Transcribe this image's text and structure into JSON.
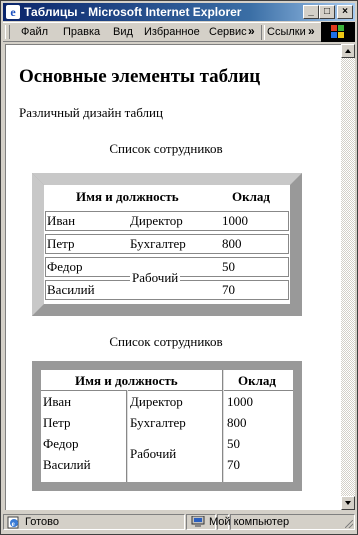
{
  "window": {
    "title": "Таблицы - Microsoft Internet Explorer",
    "buttons": {
      "minimize": "_",
      "maximize": "□",
      "close": "×"
    }
  },
  "menubar": {
    "items": [
      "Файл",
      "Правка",
      "Вид",
      "Избранное",
      "Сервис"
    ],
    "overflow": "»",
    "links_label": "Ссылки",
    "links_overflow": "»"
  },
  "page": {
    "heading": "Основные элементы таблиц",
    "subheading": "Различный дизайн таблиц",
    "table1": {
      "caption": "Список сотрудников",
      "headers": [
        "Имя и должность",
        "Оклад"
      ],
      "rows": [
        {
          "name": "Иван",
          "position": "Директор",
          "salary": "1000"
        },
        {
          "name": "Петр",
          "position": "Бухгалтер",
          "salary": "800"
        },
        {
          "name": "Федор",
          "position": "",
          "salary": "50"
        },
        {
          "name": "Василий",
          "position": "",
          "salary": "70"
        }
      ],
      "merged_position": "Рабочий"
    },
    "table2": {
      "caption": "Список сотрудников",
      "headers": [
        "Имя и должность",
        "Оклад"
      ],
      "rows": [
        {
          "name": "Иван",
          "position": "Директор",
          "salary": "1000"
        },
        {
          "name": "Петр",
          "position": "Бухгалтер",
          "salary": "800"
        },
        {
          "name": "Федор",
          "position": "",
          "salary": "50"
        },
        {
          "name": "Василий",
          "position": "",
          "salary": "70"
        }
      ],
      "merged_position": "Рабочий"
    }
  },
  "statusbar": {
    "status": "Готово",
    "zone": "Мой компьютер"
  }
}
